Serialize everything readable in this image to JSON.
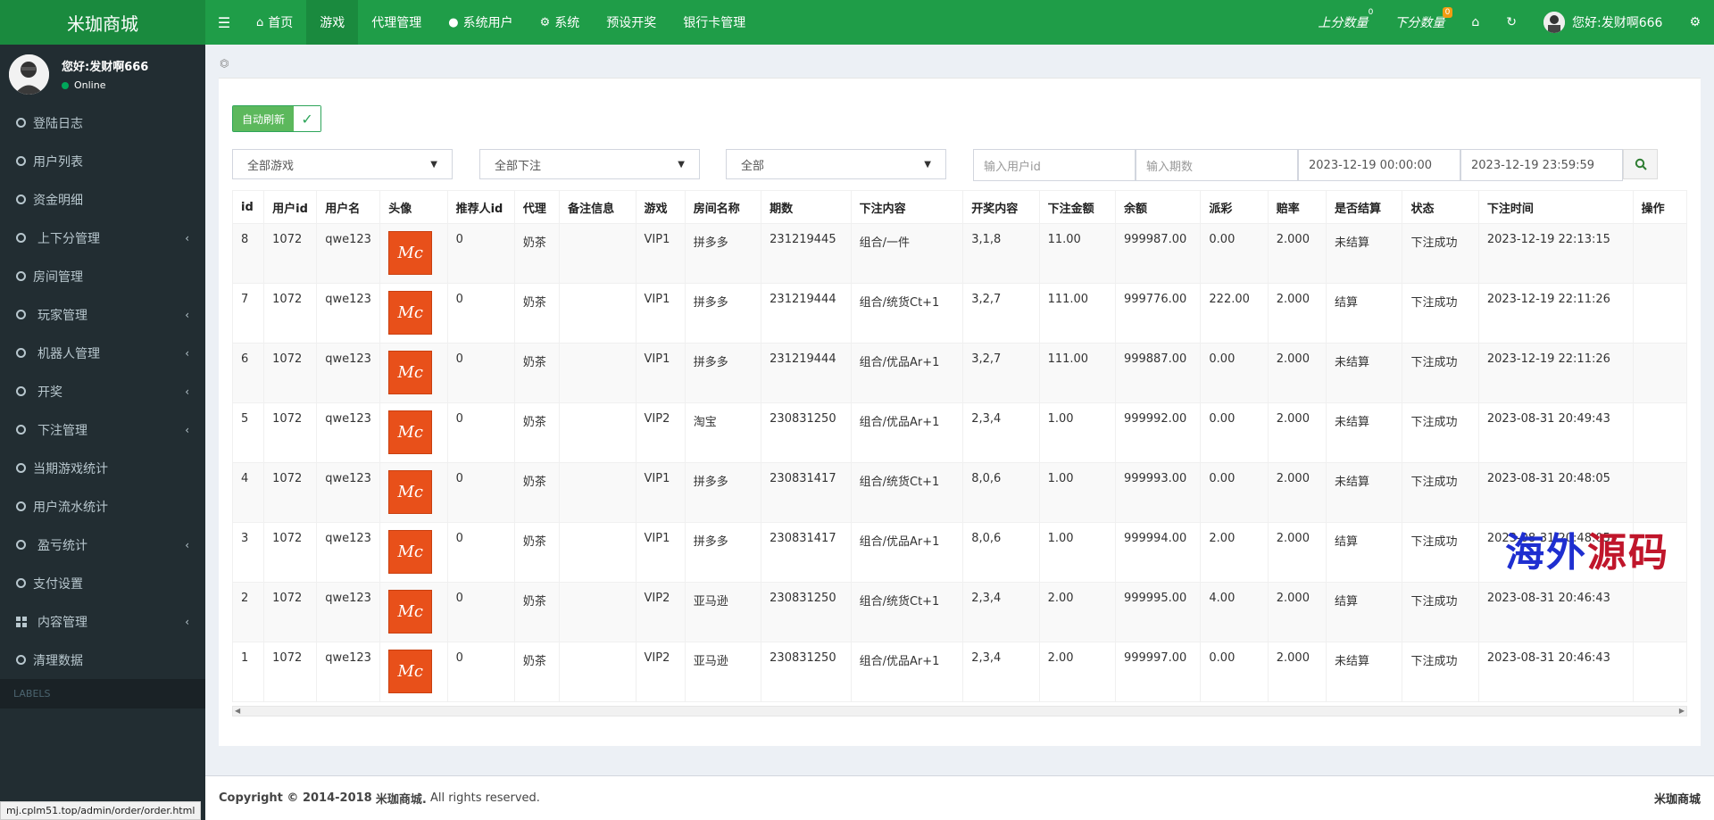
{
  "app": {
    "title": "米珈商城"
  },
  "topnav": {
    "items": [
      {
        "label": "首页",
        "icon": "home-icon"
      },
      {
        "label": "游戏",
        "icon": ""
      },
      {
        "label": "代理管理",
        "icon": ""
      },
      {
        "label": "系统用户",
        "icon": "user-icon"
      },
      {
        "label": "系统",
        "icon": "gear-icon"
      },
      {
        "label": "预设开奖",
        "icon": ""
      },
      {
        "label": "银行卡管理",
        "icon": ""
      }
    ],
    "active": "游戏",
    "right": {
      "up_score": "上分数量",
      "up_score_badge": "0",
      "down_score": "下分数量",
      "down_score_badge": "0",
      "user_greeting": "您好:发财啊666"
    }
  },
  "sidebar": {
    "user": {
      "name": "您好:发财啊666",
      "status": "Online"
    },
    "items": [
      {
        "label": "登陆日志",
        "chevron": false
      },
      {
        "label": "用户列表",
        "chevron": false
      },
      {
        "label": "资金明细",
        "chevron": false
      },
      {
        "label": "上下分管理",
        "chevron": true
      },
      {
        "label": "房间管理",
        "chevron": false
      },
      {
        "label": "玩家管理",
        "chevron": true
      },
      {
        "label": "机器人管理",
        "chevron": true
      },
      {
        "label": "开奖",
        "chevron": true
      },
      {
        "label": "下注管理",
        "chevron": true
      },
      {
        "label": "当期游戏统计",
        "chevron": false
      },
      {
        "label": "用户流水统计",
        "chevron": false
      },
      {
        "label": "盈亏统计",
        "chevron": true
      },
      {
        "label": "支付设置",
        "chevron": false
      },
      {
        "label": "内容管理",
        "chevron": true
      },
      {
        "label": "清理数据",
        "chevron": false
      }
    ],
    "labels_header": "LABELS"
  },
  "status_url": "mj.cplm51.top/admin/order/order.html",
  "toolbar": {
    "auto_refresh": "自动刷新"
  },
  "filters": {
    "game": "全部游戏",
    "bet": "全部下注",
    "all": "全部",
    "user_id_placeholder": "输入用户id",
    "period_placeholder": "输入期数",
    "start_time": "2023-12-19 00:00:00",
    "end_time": "2023-12-19 23:59:59"
  },
  "table": {
    "columns": [
      "id",
      "用户id",
      "用户名",
      "头像",
      "推荐人id",
      "代理",
      "备注信息",
      "游戏",
      "房间名称",
      "期数",
      "下注内容",
      "开奖内容",
      "下注金额",
      "余额",
      "派彩",
      "赔率",
      "是否结算",
      "状态",
      "下注时间",
      "操作"
    ],
    "rows": [
      [
        "8",
        "1072",
        "qwe123",
        "",
        "0",
        "奶茶",
        "",
        "VIP1",
        "拼多多",
        "231219445",
        "组合/一件",
        "3,1,8",
        "11.00",
        "999987.00",
        "0.00",
        "2.000",
        "未结算",
        "下注成功",
        "2023-12-19 22:13:15",
        ""
      ],
      [
        "7",
        "1072",
        "qwe123",
        "",
        "0",
        "奶茶",
        "",
        "VIP1",
        "拼多多",
        "231219444",
        "组合/统货Ct+1",
        "3,2,7",
        "111.00",
        "999776.00",
        "222.00",
        "2.000",
        "结算",
        "下注成功",
        "2023-12-19 22:11:26",
        ""
      ],
      [
        "6",
        "1072",
        "qwe123",
        "",
        "0",
        "奶茶",
        "",
        "VIP1",
        "拼多多",
        "231219444",
        "组合/优品Ar+1",
        "3,2,7",
        "111.00",
        "999887.00",
        "0.00",
        "2.000",
        "未结算",
        "下注成功",
        "2023-12-19 22:11:26",
        ""
      ],
      [
        "5",
        "1072",
        "qwe123",
        "",
        "0",
        "奶茶",
        "",
        "VIP2",
        "淘宝",
        "230831250",
        "组合/优品Ar+1",
        "2,3,4",
        "1.00",
        "999992.00",
        "0.00",
        "2.000",
        "未结算",
        "下注成功",
        "2023-08-31 20:49:43",
        ""
      ],
      [
        "4",
        "1072",
        "qwe123",
        "",
        "0",
        "奶茶",
        "",
        "VIP1",
        "拼多多",
        "230831417",
        "组合/统货Ct+1",
        "8,0,6",
        "1.00",
        "999993.00",
        "0.00",
        "2.000",
        "未结算",
        "下注成功",
        "2023-08-31 20:48:05",
        ""
      ],
      [
        "3",
        "1072",
        "qwe123",
        "",
        "0",
        "奶茶",
        "",
        "VIP1",
        "拼多多",
        "230831417",
        "组合/优品Ar+1",
        "8,0,6",
        "1.00",
        "999994.00",
        "2.00",
        "2.000",
        "结算",
        "下注成功",
        "2023-08-31 20:48:05",
        ""
      ],
      [
        "2",
        "1072",
        "qwe123",
        "",
        "0",
        "奶茶",
        "",
        "VIP2",
        "亚马逊",
        "230831250",
        "组合/统货Ct+1",
        "2,3,4",
        "2.00",
        "999995.00",
        "4.00",
        "2.000",
        "结算",
        "下注成功",
        "2023-08-31 20:46:43",
        ""
      ],
      [
        "1",
        "1072",
        "qwe123",
        "",
        "0",
        "奶茶",
        "",
        "VIP2",
        "亚马逊",
        "230831250",
        "组合/优品Ar+1",
        "2,3,4",
        "2.00",
        "999997.00",
        "0.00",
        "2.000",
        "未结算",
        "下注成功",
        "2023-08-31 20:46:43",
        ""
      ]
    ],
    "avatar_text": "Mc"
  },
  "watermark": {
    "part1": "海外",
    "part2": "源码"
  },
  "footer": {
    "copyright_prefix": "Copyright © 2014-2018",
    "brand": "米珈商城.",
    "suffix": "All rights reserved.",
    "right": "米珈商城"
  },
  "colors": {
    "header": "#1f9d48",
    "sidebar": "#222d32",
    "accent": "#5cb85c"
  }
}
